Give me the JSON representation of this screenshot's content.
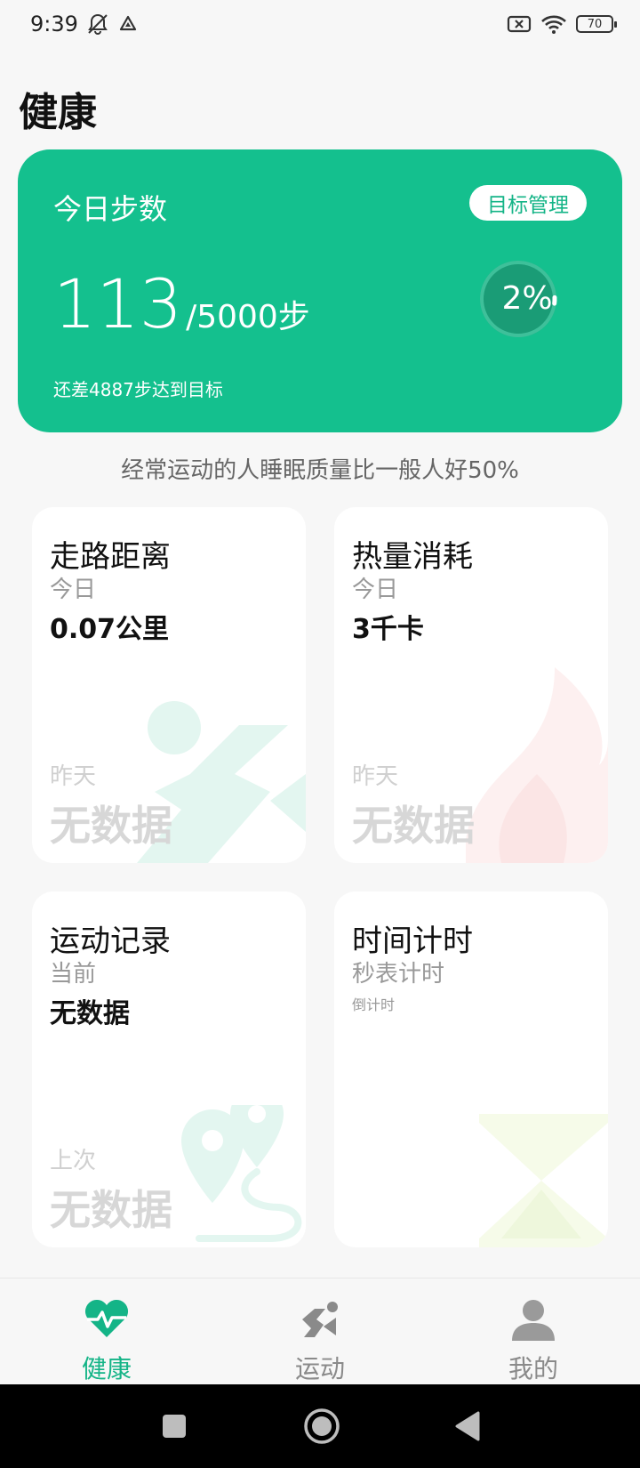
{
  "status_bar": {
    "time": "9:39",
    "battery": "70",
    "icons": [
      "bell-off-icon",
      "drive-icon",
      "sim-x-icon",
      "wifi-icon",
      "battery-icon"
    ]
  },
  "page_title": "健康",
  "steps_card": {
    "label": "今日步数",
    "goal_button": "目标管理",
    "value": "113",
    "total": "/5000步",
    "remaining": "还差4887步达到目标",
    "progress_text": "2%",
    "progress": 0.02,
    "color": "#14c08e"
  },
  "tip": "经常运动的人睡眠质量比一般人好50%",
  "tiles": {
    "walk": {
      "title": "走路距离",
      "subtitle": "今日",
      "value": "0.07公里",
      "prev_label": "昨天",
      "prev_value": "无数据",
      "icon": "running-icon"
    },
    "calories": {
      "title": "热量消耗",
      "subtitle": "今日",
      "value": "3千卡",
      "prev_label": "昨天",
      "prev_value": "无数据",
      "icon": "flame-icon"
    },
    "records": {
      "title": "运动记录",
      "subtitle": "当前",
      "value": "无数据",
      "prev_label": "上次",
      "prev_value": "无数据",
      "icon": "route-icon"
    },
    "timer": {
      "title": "时间计时",
      "subtitle": "秒表计时",
      "small": "倒计时",
      "icon": "hourglass-icon"
    }
  },
  "bottom_nav": {
    "items": [
      {
        "label": "健康",
        "icon": "heart-pulse-icon",
        "active": true
      },
      {
        "label": "运动",
        "icon": "sport-icon",
        "active": false
      },
      {
        "label": "我的",
        "icon": "person-icon",
        "active": false
      }
    ],
    "active_color": "#14b487",
    "inactive_color": "#8a8a8a"
  }
}
